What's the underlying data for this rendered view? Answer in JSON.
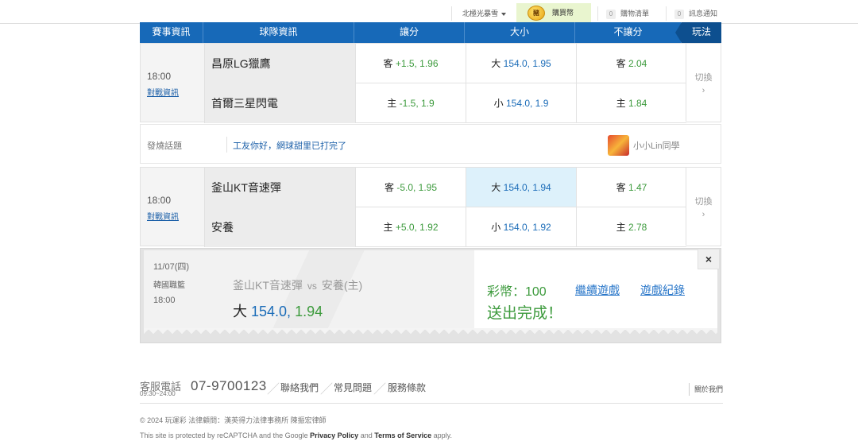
{
  "topbar": {
    "user": "北極光暴雪",
    "buy_coin": "豬",
    "buy_label": "購買幣",
    "cart_count": "0",
    "cart_label": "購物清單",
    "notice_count": "0",
    "notice_label": "訊息通知"
  },
  "table_header": {
    "event": "賽事資訊",
    "team": "球隊資訊",
    "spread": "讓分",
    "total": "大小",
    "moneyline": "不讓分",
    "play": "玩法"
  },
  "matches": [
    {
      "time": "18:00",
      "info_link": "對戰資訊",
      "away": {
        "name": "昌原LG獵鷹",
        "spread_prefix": "客",
        "spread_value": "+1.5, 1.96",
        "total_prefix": "大",
        "total_value": "154.0, 1.95",
        "ml_prefix": "客",
        "ml_value": "2.04"
      },
      "home": {
        "name": "首爾三星閃電",
        "spread_prefix": "主",
        "spread_value": "-1.5, 1.9",
        "total_prefix": "小",
        "total_value": "154.0, 1.9",
        "ml_prefix": "主",
        "ml_value": "1.84"
      },
      "switch_label": "切換",
      "switch_arrow": "›"
    },
    {
      "time": "18:00",
      "info_link": "對戰資訊",
      "away": {
        "name": "釜山KT音速彈",
        "spread_prefix": "客",
        "spread_value": "-5.0, 1.95",
        "total_prefix": "大",
        "total_value": "154.0, 1.94",
        "ml_prefix": "客",
        "ml_value": "1.47"
      },
      "home": {
        "name": "安養",
        "spread_prefix": "主",
        "spread_value": "+5.0, 1.92",
        "total_prefix": "小",
        "total_value": "154.0, 1.92",
        "ml_prefix": "主",
        "ml_value": "2.78"
      },
      "switch_label": "切換",
      "switch_arrow": "›"
    }
  ],
  "topic": {
    "label": "發燒話題",
    "message": "工友你好，網球甜里已打完了",
    "user": "小小Lin同學",
    "avatar_icon": "user-avatar-icon"
  },
  "receipt": {
    "date": "11/07(四)",
    "league": "韓國職籃",
    "time": "18:00",
    "team_a": "釜山KT音速彈",
    "vs": "vs",
    "team_b": "安養(主)",
    "bet_type": "大",
    "bet_line": "154.0,",
    "bet_odds": "1.94",
    "credit": "彩幣：100",
    "status": "送出完成！",
    "continue_link": "繼續遊戲",
    "history_link": "遊戲紀錄",
    "close": "×"
  },
  "footer": {
    "service_label": "客服電話",
    "hours": "09:30~24:00",
    "phone": "07-9700123",
    "slash": "／",
    "contact": "聯絡我們",
    "faq": "常見問題",
    "terms": "服務條款",
    "about": "關於我們",
    "copyright": "© 2024 玩運彩 法律顧問：漢英得力法律事務所 陳振宏律師",
    "recaptcha_prefix": "This site is protected by reCAPTCHA and the Google",
    "privacy": "Privacy Policy",
    "and": "and",
    "tos": "Terms of Service",
    "apply": "apply."
  },
  "colors": {
    "header_blue": "#1769b8",
    "odds_green": "#3c9a3c",
    "link_blue": "#2a77c9",
    "highlight": "#ddf1fb"
  }
}
